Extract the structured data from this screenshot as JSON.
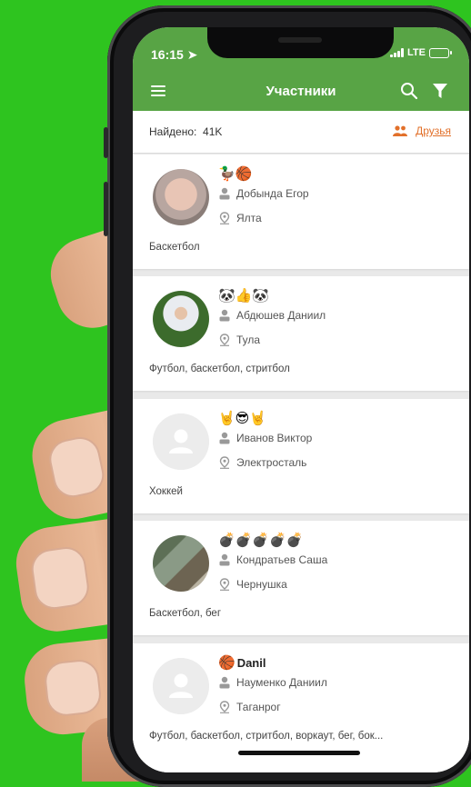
{
  "status": {
    "time": "16:15",
    "network": "LTE"
  },
  "toolbar": {
    "title": "Участники"
  },
  "found": {
    "label": "Найдено:",
    "count": "41K",
    "friends_link": "Друзья"
  },
  "users": [
    {
      "emoji": "🦆🏀",
      "nick": "",
      "name": "Добында Егор",
      "city": "Ялта",
      "interests": "Баскетбол"
    },
    {
      "emoji": "🐼👍🐼",
      "nick": "",
      "name": "Абдюшев Даниил",
      "city": "Тула",
      "interests": "Футбол, баскетбол, стритбол"
    },
    {
      "emoji": "🤘😎🤘",
      "nick": "",
      "name": "Иванов Виктор",
      "city": "Электросталь",
      "interests": "Хоккей"
    },
    {
      "emoji": "💣💣💣💣💣",
      "nick": "",
      "name": "Кондратьев Саша",
      "city": "Чернушка",
      "interests": "Баскетбол, бег"
    },
    {
      "emoji": "🏀",
      "nick": "Danil",
      "name": "Науменко Даниил",
      "city": "Таганрог",
      "interests": "Футбол, баскетбол, стритбол, воркаут, бег, бок..."
    }
  ],
  "colors": {
    "header": "#58a445",
    "accent": "#e2702a",
    "background": "#2ec41f"
  }
}
